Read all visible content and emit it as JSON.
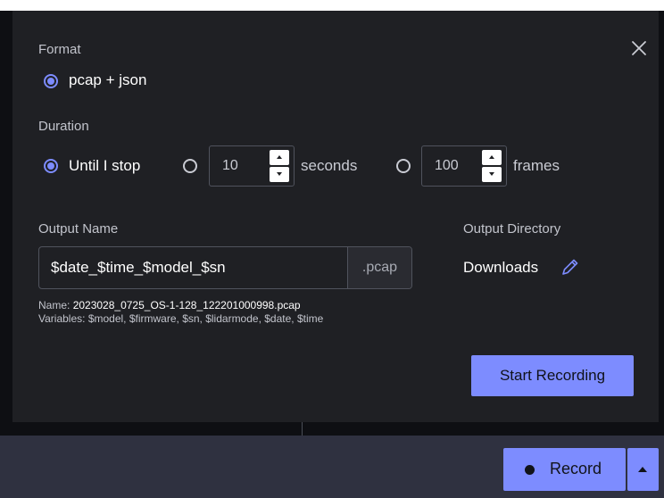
{
  "dialog": {
    "format": {
      "label": "Format",
      "options": [
        {
          "label": "pcap + json",
          "selected": true
        }
      ]
    },
    "duration": {
      "label": "Duration",
      "options": [
        {
          "label": "Until I stop",
          "selected": true
        },
        {
          "value": "10",
          "unit": "seconds",
          "selected": false
        },
        {
          "value": "100",
          "unit": "frames",
          "selected": false
        }
      ]
    },
    "output_name": {
      "label": "Output Name",
      "value": "$date_$time_$model_$sn",
      "extension": ".pcap",
      "name_label": "Name:",
      "name_preview": "2023028_0725_OS-1-128_122201000998.pcap",
      "variables_label": "Variables:",
      "variables": "$model, $firmware, $sn, $lidarmode, $date, $time"
    },
    "output_directory": {
      "label": "Output Directory",
      "value": "Downloads",
      "edit_icon": "pencil-icon"
    },
    "start_button": "Start Recording",
    "close_icon": "close-icon"
  },
  "toolbar": {
    "record_label": "Record",
    "record_dot_icon": "record-dot-icon",
    "caret_icon": "caret-up-icon"
  },
  "colors": {
    "accent": "#7d8cff",
    "dialog_bg": "#1f2024",
    "bar_bg": "#2f3140"
  }
}
